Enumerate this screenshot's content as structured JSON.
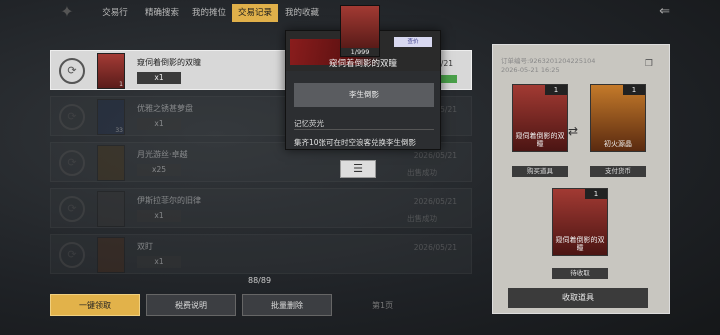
{
  "nav": {
    "tabs": [
      {
        "label": "交易行"
      },
      {
        "label": "精确搜索"
      },
      {
        "label": "我的摊位"
      },
      {
        "label": "交易记录"
      },
      {
        "label": "我的收藏"
      }
    ],
    "active_tab": "交易记录",
    "back_icon": "back-arrow-icon"
  },
  "list": {
    "rows": [
      {
        "name": "窥伺着倒影的双瞳",
        "qty": "x1",
        "count": "1",
        "date": "05/21",
        "status": ""
      },
      {
        "name": "优雅之锈甚萝盘",
        "qty": "x1",
        "count": "33",
        "date": "2026/05/21",
        "status": ""
      },
      {
        "name": "月光游丝·卓越",
        "qty": "x25",
        "count": "",
        "date": "2026/05/21",
        "status": "出售成功"
      },
      {
        "name": "伊斯拉菲尔的旧律",
        "qty": "x1",
        "count": "",
        "date": "2026/05/21",
        "status": "出售成功"
      },
      {
        "name": "双盯",
        "qty": "x1",
        "count": "",
        "date": "2026/05/21",
        "status": ""
      }
    ],
    "counter": "88/89"
  },
  "buttons": {
    "claim_all": "一键领取",
    "tax_info": "税费说明",
    "bulk_delete": "批量删除",
    "page": "第1页"
  },
  "detail_panel": {
    "order_line1": "订单编号:9263201204225104",
    "order_line2": "2026-05-21 16:25",
    "buy_item": {
      "count": "1",
      "label": "窥伺着倒影的双瞳",
      "caption": "购买道具"
    },
    "pay_item": {
      "count": "1",
      "label": "初火源晶",
      "caption": "支付货币"
    },
    "pending_item": {
      "count": "1",
      "label": "窥伺着倒影的双瞳",
      "caption": "待收取"
    },
    "collect_button": "收取道具"
  },
  "popup": {
    "card_count": "1/999",
    "mark": "查价",
    "title": "窥伺着倒影的双瞳",
    "owner_button": "李生倒影",
    "label": "记忆荧光",
    "description": "集齐10张可在时空浪客兑换李生倒影",
    "close_icon": "menu-lines-icon"
  },
  "colors": {
    "accent_gold": "#e2b24a",
    "card_red": "#a23a33",
    "panel_bg": "#c8c6c0"
  }
}
